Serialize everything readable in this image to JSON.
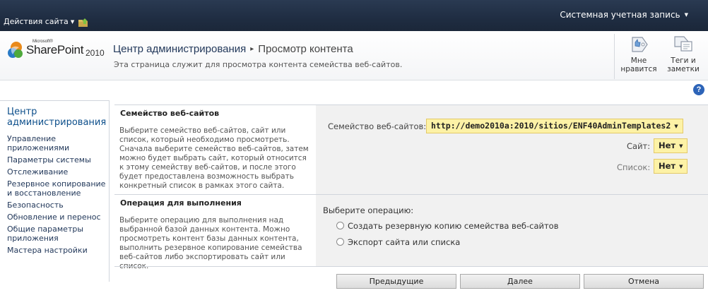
{
  "topbar": {
    "site_actions_label": "Действия сайта",
    "account_label": "Системная учетная запись"
  },
  "logo": {
    "microsoft": "Microsoft®",
    "sharepoint": "SharePoint",
    "year": "2010"
  },
  "title": {
    "breadcrumb_root": "Центр администрирования",
    "separator": "▸",
    "current_page": "Просмотр контента",
    "description": "Эта страница служит для просмотра контента семейства веб-сайтов."
  },
  "ribbon": {
    "like_label_1": "Мне",
    "like_label_2": "нравится",
    "tags_label_1": "Теги и",
    "tags_label_2": "заметки"
  },
  "help": {
    "icon": "help-icon",
    "glyph": "?"
  },
  "leftnav": {
    "heading": "Центр администрирования",
    "items": [
      "Управление приложениями",
      "Параметры системы",
      "Отслеживание",
      "Резервное копирование и восстановление",
      "Безопасность",
      "Обновление и перенос",
      "Общие параметры приложения",
      "Мастера настройки"
    ]
  },
  "section_site_collection": {
    "title": "Семейство веб-сайтов",
    "description": "Выберите семейство веб-сайтов, сайт или список, который необходимо просмотреть. Сначала выберите семейство веб-сайтов, затем можно будет выбрать сайт, который относится к этому семейству веб-сайтов, и после этого будет предоставлена возможность выбрать конкретный список в рамках этого сайта.",
    "collection_label": "Семейство веб-сайтов:",
    "collection_value": "http://demo2010a:2010/sitios/ENF40AdminTemplates2",
    "site_label": "Сайт:",
    "site_value": "Нет",
    "list_label": "Список:",
    "list_value": "Нет"
  },
  "section_operation": {
    "title": "Операция для выполнения",
    "description": "Выберите операцию для выполнения над выбранной базой данных контента. Можно просмотреть контент базы данных контента, выполнить резервное копирование семейства веб-сайтов либо экспортировать сайт или список.",
    "prompt": "Выберите операцию:",
    "options": [
      "Создать резервную копию семейства веб-сайтов",
      "Экспорт сайта или списка"
    ]
  },
  "buttons": {
    "previous": "Предыдущие",
    "next": "Далее",
    "cancel": "Отмена"
  },
  "colors": {
    "topbar": "#1f2d42",
    "link": "#23395b",
    "dropdown_bg": "#fdf2a6",
    "control_bg": "#f1f1f1"
  }
}
